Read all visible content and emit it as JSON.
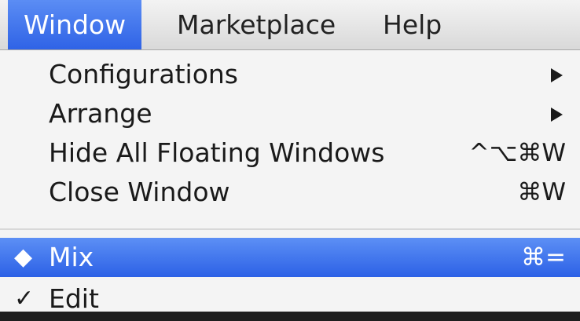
{
  "menubar": {
    "window": "Window",
    "marketplace": "Marketplace",
    "help": "Help"
  },
  "menu": {
    "items": [
      {
        "label": "Configurations",
        "shortcut": "",
        "submenu": true
      },
      {
        "label": "Arrange",
        "shortcut": "",
        "submenu": true
      },
      {
        "label": "Hide All Floating Windows",
        "shortcut": "^⌥⌘W",
        "submenu": false
      },
      {
        "label": "Close Window",
        "shortcut": "⌘W",
        "submenu": false
      },
      {
        "label": "Mix",
        "shortcut": "⌘=",
        "mark": "◆",
        "highlighted": true
      },
      {
        "label": "Edit",
        "shortcut": "",
        "mark": "✓"
      }
    ]
  },
  "colors": {
    "highlight": "#3a6ff0",
    "menu_bg": "#f4f4f4"
  }
}
